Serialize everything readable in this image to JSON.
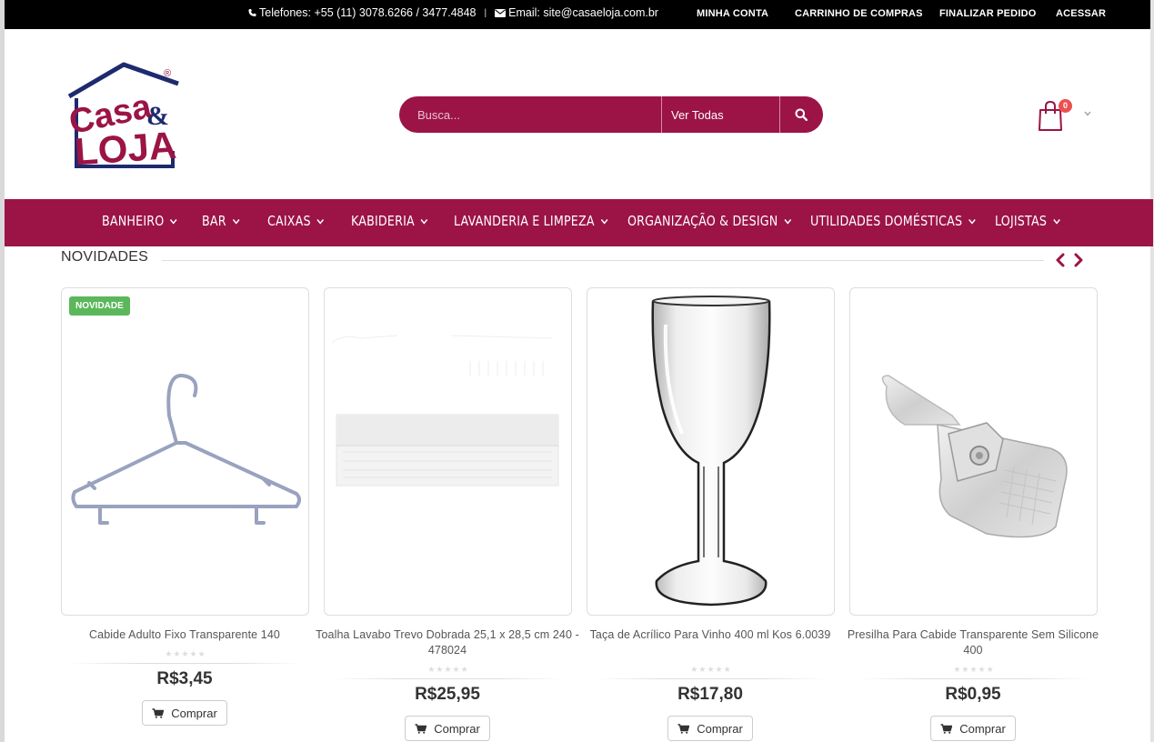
{
  "topbar": {
    "phone": "Telefones: +55 (11) 3078.6266 / 3477.4848",
    "separator": "|",
    "email": "Email: site@casaeloja.com.br",
    "links": [
      "MINHA CONTA",
      "CARRINHO DE COMPRAS",
      "FINALIZAR PEDIDO",
      "ACESSAR"
    ]
  },
  "logo": {
    "word1": "Casa",
    "amp": "&",
    "word2": "LOJA",
    "reg": "®"
  },
  "search": {
    "placeholder": "Busca...",
    "category": "Ver Todas"
  },
  "cart": {
    "count": "0"
  },
  "nav": [
    "BANHEIRO",
    "BAR",
    "CAIXAS",
    "KABIDERIA",
    "LAVANDERIA E LIMPEZA",
    "ORGANIZAÇÃO & DESIGN",
    "UTILIDADES DOMÉSTICAS",
    "LOJISTAS"
  ],
  "section": {
    "title": "NOVIDADES"
  },
  "products": [
    {
      "badge": "NOVIDADE",
      "name": "Cabide Adulto Fixo Transparente 140",
      "price": "R$3,45",
      "rating": 0,
      "buy": "Comprar",
      "image": "hanger"
    },
    {
      "name": "Toalha Lavabo Trevo Dobrada 25,1 x 28,5 cm 240 - 478024",
      "price": "R$25,95",
      "rating": 0,
      "buy": "Comprar",
      "image": "towel"
    },
    {
      "name": "Taça de Acrílico Para Vinho 400 ml Kos 6.0039",
      "price": "R$17,80",
      "rating": 0,
      "buy": "Comprar",
      "image": "wine-glass"
    },
    {
      "name": "Presilha Para Cabide Transparente Sem Silicone 400",
      "price": "R$0,95",
      "rating": 0,
      "buy": "Comprar",
      "image": "clip"
    }
  ],
  "colors": {
    "brand": "#9b1445",
    "topbar": "#000000",
    "badge_new": "#5bb75b",
    "cart_badge": "#ed4f4f",
    "logo_blue": "#1e2a6e"
  },
  "icons": [
    "phone-icon",
    "envelope-icon",
    "search-icon",
    "cart-bag-icon",
    "chevron-down-icon",
    "chevron-left-icon",
    "chevron-right-icon",
    "shopping-cart-icon",
    "star-icon"
  ]
}
